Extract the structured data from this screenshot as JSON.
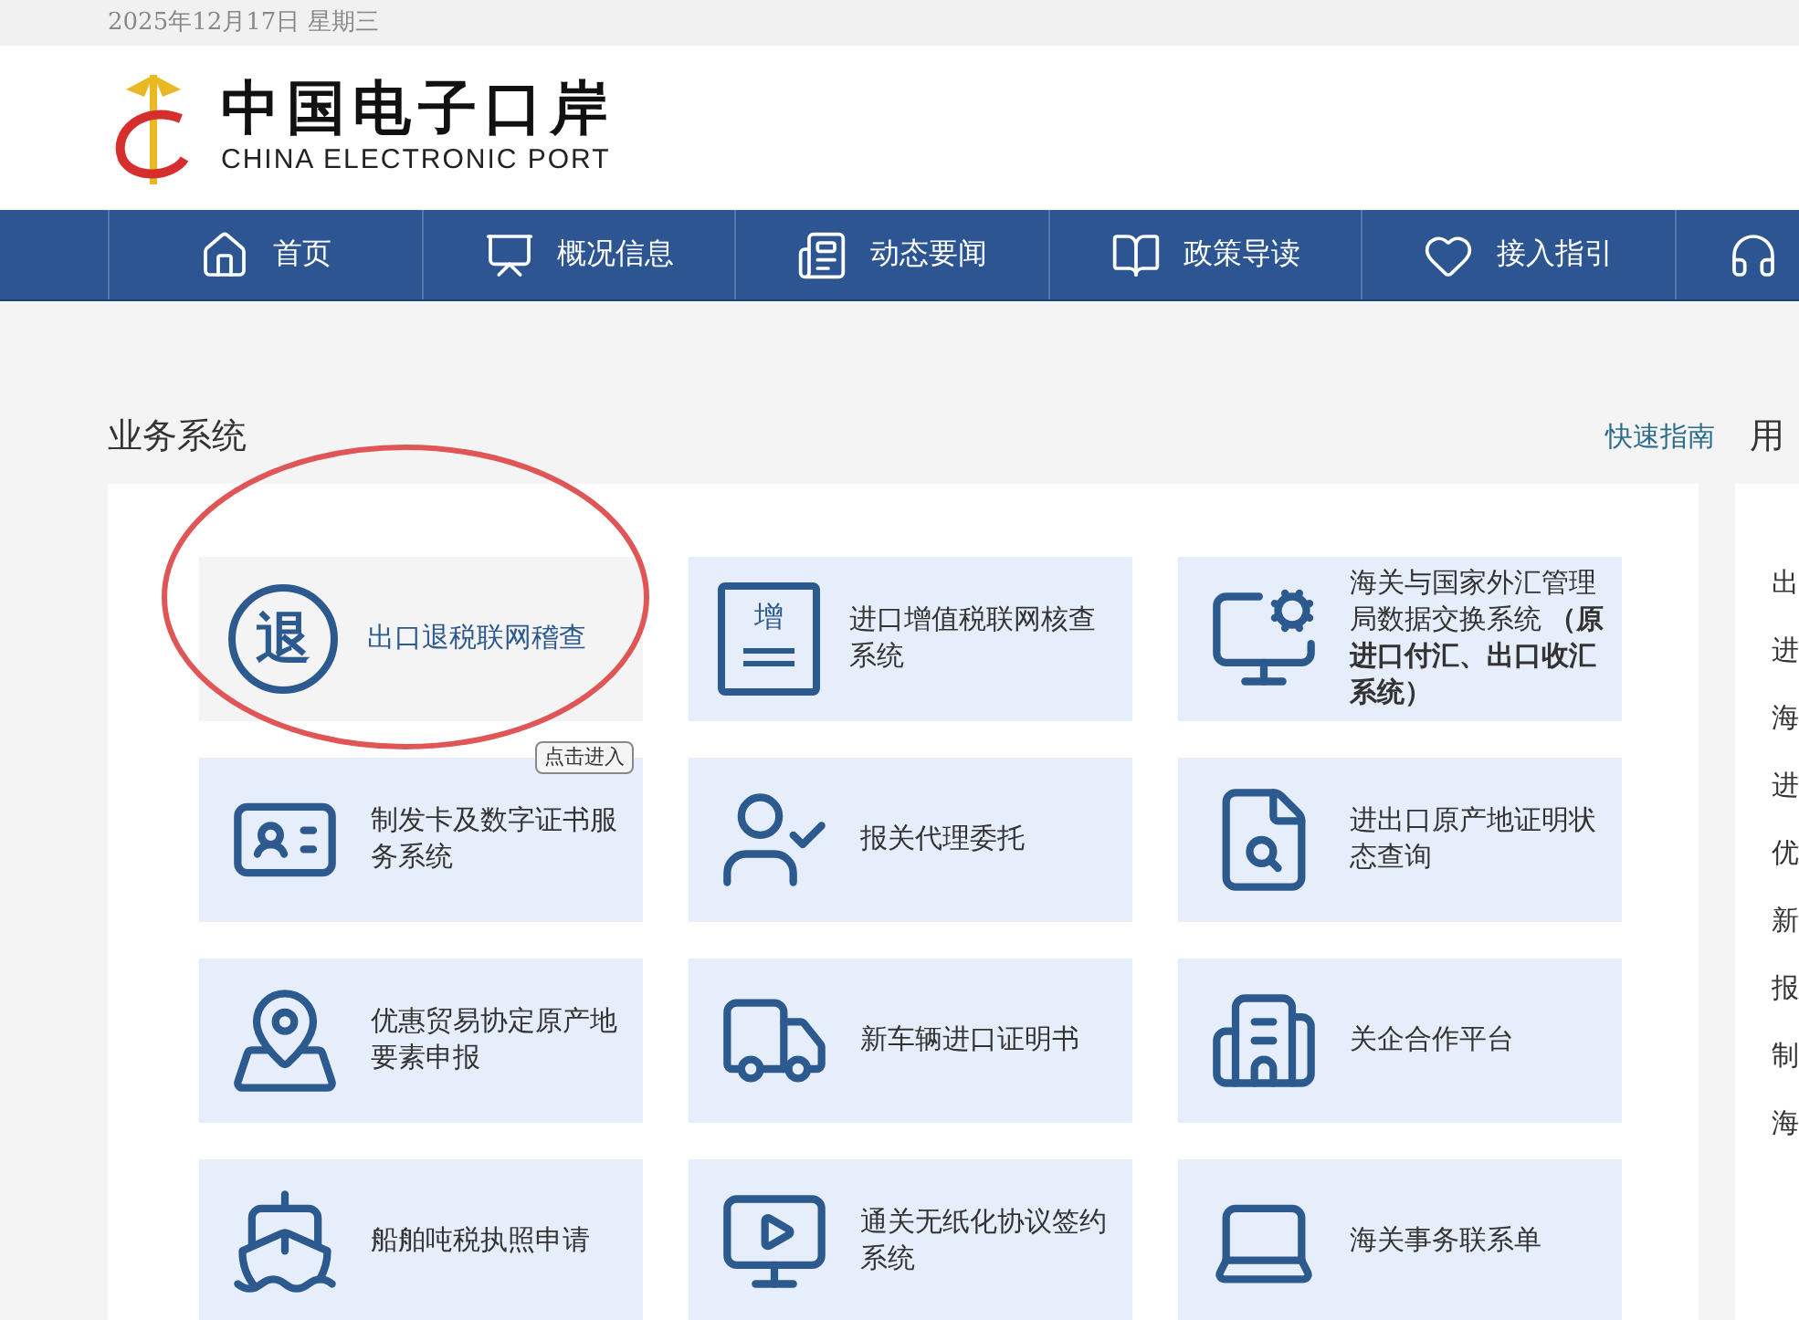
{
  "top_bar": {
    "date": "2025年12月17日 星期三"
  },
  "logo": {
    "title": "中国电子口岸",
    "subtitle": "CHINA ELECTRONIC PORT"
  },
  "nav": [
    {
      "label": "首页"
    },
    {
      "label": "概况信息"
    },
    {
      "label": "动态要闻"
    },
    {
      "label": "政策导读"
    },
    {
      "label": "接入指引"
    }
  ],
  "section": {
    "title": "业务系统",
    "link": "快速指南"
  },
  "systems": [
    {
      "icon_text": "退",
      "label": "出口退税联网稽查",
      "hovered": true
    },
    {
      "icon_text": "增",
      "label": "进口增值税联网核查系统",
      "hovered": false
    },
    {
      "label": "海关与国家外汇管理局数据交换系统 **（原进口付汇、出口收汇系统）**",
      "hovered": false
    },
    {
      "label": "制发卡及数字证书服务系统",
      "hovered": false
    },
    {
      "label": "报关代理委托",
      "hovered": false
    },
    {
      "label": "进出口原产地证明状态查询",
      "hovered": false
    },
    {
      "label": "优惠贸易协定原产地要素申报",
      "hovered": false
    },
    {
      "label": "新车辆进口证明书",
      "hovered": false
    },
    {
      "label": "关企合作平台",
      "hovered": false
    },
    {
      "label": "船舶吨税执照申请",
      "hovered": false
    },
    {
      "label": "通关无纸化协议签约系统",
      "hovered": false
    },
    {
      "label": "海关事务联系单",
      "hovered": false
    }
  ],
  "tooltip": "点击进入",
  "annotation": {
    "visible": true
  },
  "side_panel": {
    "title": "用",
    "items": [
      "出",
      "进",
      "海",
      "进",
      "优",
      "新",
      "报",
      "制",
      "海"
    ]
  }
}
